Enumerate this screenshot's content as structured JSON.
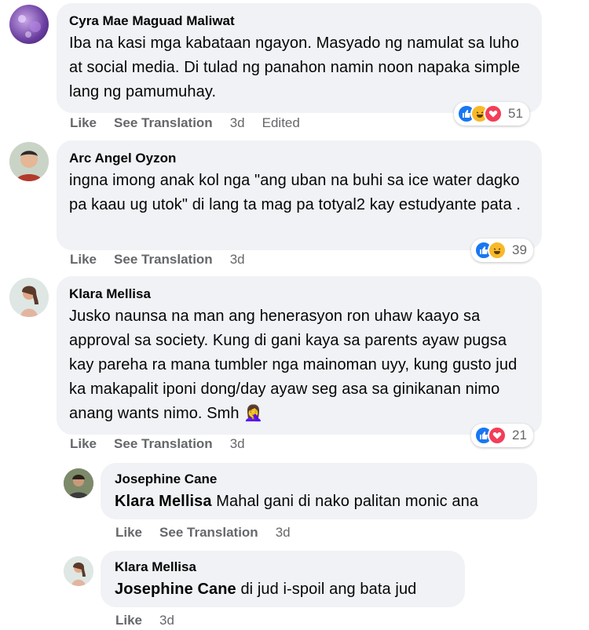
{
  "comments": [
    {
      "author": "Cyra Mae Maguad Maliwat",
      "text": "Iba na kasi mga kabataan ngayon. Masyado ng namulat sa luho at social media. Di tulad ng panahon namin noon napaka simple lang ng pamumuhay.",
      "like": "Like",
      "translate": "See Translation",
      "time": "3d",
      "edited": "Edited",
      "reactions": [
        "like-icon",
        "haha-icon",
        "love-icon"
      ],
      "count": "51"
    },
    {
      "author": "Arc Angel Oyzon",
      "text": "ingna imong anak kol nga \"ang uban na buhi sa ice water dagko pa kaau ug utok\" di lang ta mag pa totyal2 kay estudyante pata .",
      "like": "Like",
      "translate": "See Translation",
      "time": "3d",
      "reactions": [
        "like-icon",
        "haha-icon"
      ],
      "count": "39"
    },
    {
      "author": "Klara Mellisa",
      "text": "Jusko naunsa na man ang henerasyon ron uhaw kaayo sa approval sa society. Kung di gani kaya sa parents ayaw pugsa kay pareha ra mana tumbler nga mainoman uyy, kung gusto jud ka makapalit iponi dong/day ayaw seg asa sa ginikanan nimo anang wants nimo. Smh",
      "emoji": "🤦‍♀️",
      "like": "Like",
      "translate": "See Translation",
      "time": "3d",
      "reactions": [
        "like-icon",
        "love-icon"
      ],
      "count": "21"
    }
  ],
  "replies": [
    {
      "author": "Josephine Cane",
      "mention": "Klara Mellisa",
      "text": " Mahal gani di nako palitan monic ana",
      "like": "Like",
      "translate": "See Translation",
      "time": "3d"
    },
    {
      "author": "Klara Mellisa",
      "mention": "Josephine Cane",
      "text": " di jud i-spoil ang bata jud",
      "like": "Like",
      "time": "3d"
    }
  ]
}
